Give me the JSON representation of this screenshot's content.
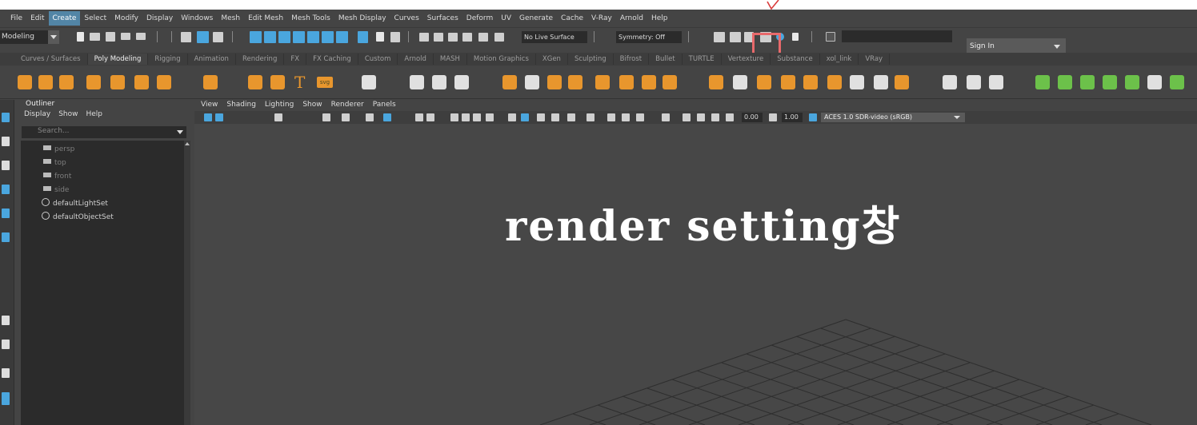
{
  "menubar": {
    "items": [
      "File",
      "Edit",
      "Create",
      "Select",
      "Modify",
      "Display",
      "Windows",
      "Mesh",
      "Edit Mesh",
      "Mesh Tools",
      "Mesh Display",
      "Curves",
      "Surfaces",
      "Deform",
      "UV",
      "Generate",
      "Cache",
      "V-Ray",
      "Arnold",
      "Help"
    ],
    "active": "Create"
  },
  "statusline": {
    "menu_set": "Modeling",
    "live_surface": "No Live Surface",
    "symmetry": "Symmetry: Off",
    "sign_in": "Sign In",
    "highlight_color": "#e8696b"
  },
  "shelf": {
    "tabs": [
      "Curves / Surfaces",
      "Poly Modeling",
      "Rigging",
      "Animation",
      "Rendering",
      "FX",
      "FX Caching",
      "Custom",
      "Arnold",
      "MASH",
      "Motion Graphics",
      "XGen",
      "Sculpting",
      "Bifrost",
      "Bullet",
      "TURTLE",
      "Vertexture",
      "Substance",
      "xol_link",
      "VRay"
    ],
    "active": "Poly Modeling",
    "text_tool": "T",
    "svg_tool": "svg"
  },
  "outliner": {
    "title": "Outliner",
    "menu": [
      "Display",
      "Show",
      "Help"
    ],
    "search_placeholder": "Search...",
    "items": [
      {
        "label": "persp",
        "icon": "camera-icon",
        "dim": true
      },
      {
        "label": "top",
        "icon": "camera-icon",
        "dim": true
      },
      {
        "label": "front",
        "icon": "camera-icon",
        "dim": true
      },
      {
        "label": "side",
        "icon": "camera-icon",
        "dim": true
      },
      {
        "label": "defaultLightSet",
        "icon": "set-icon",
        "dim": false
      },
      {
        "label": "defaultObjectSet",
        "icon": "set-icon",
        "dim": false
      }
    ]
  },
  "viewport": {
    "menu": [
      "View",
      "Shading",
      "Lighting",
      "Show",
      "Renderer",
      "Panels"
    ],
    "exposure": "0.00",
    "gamma": "1.00",
    "color_space": "ACES 1.0 SDR-video (sRGB)",
    "overlay_text": "render setting창"
  }
}
